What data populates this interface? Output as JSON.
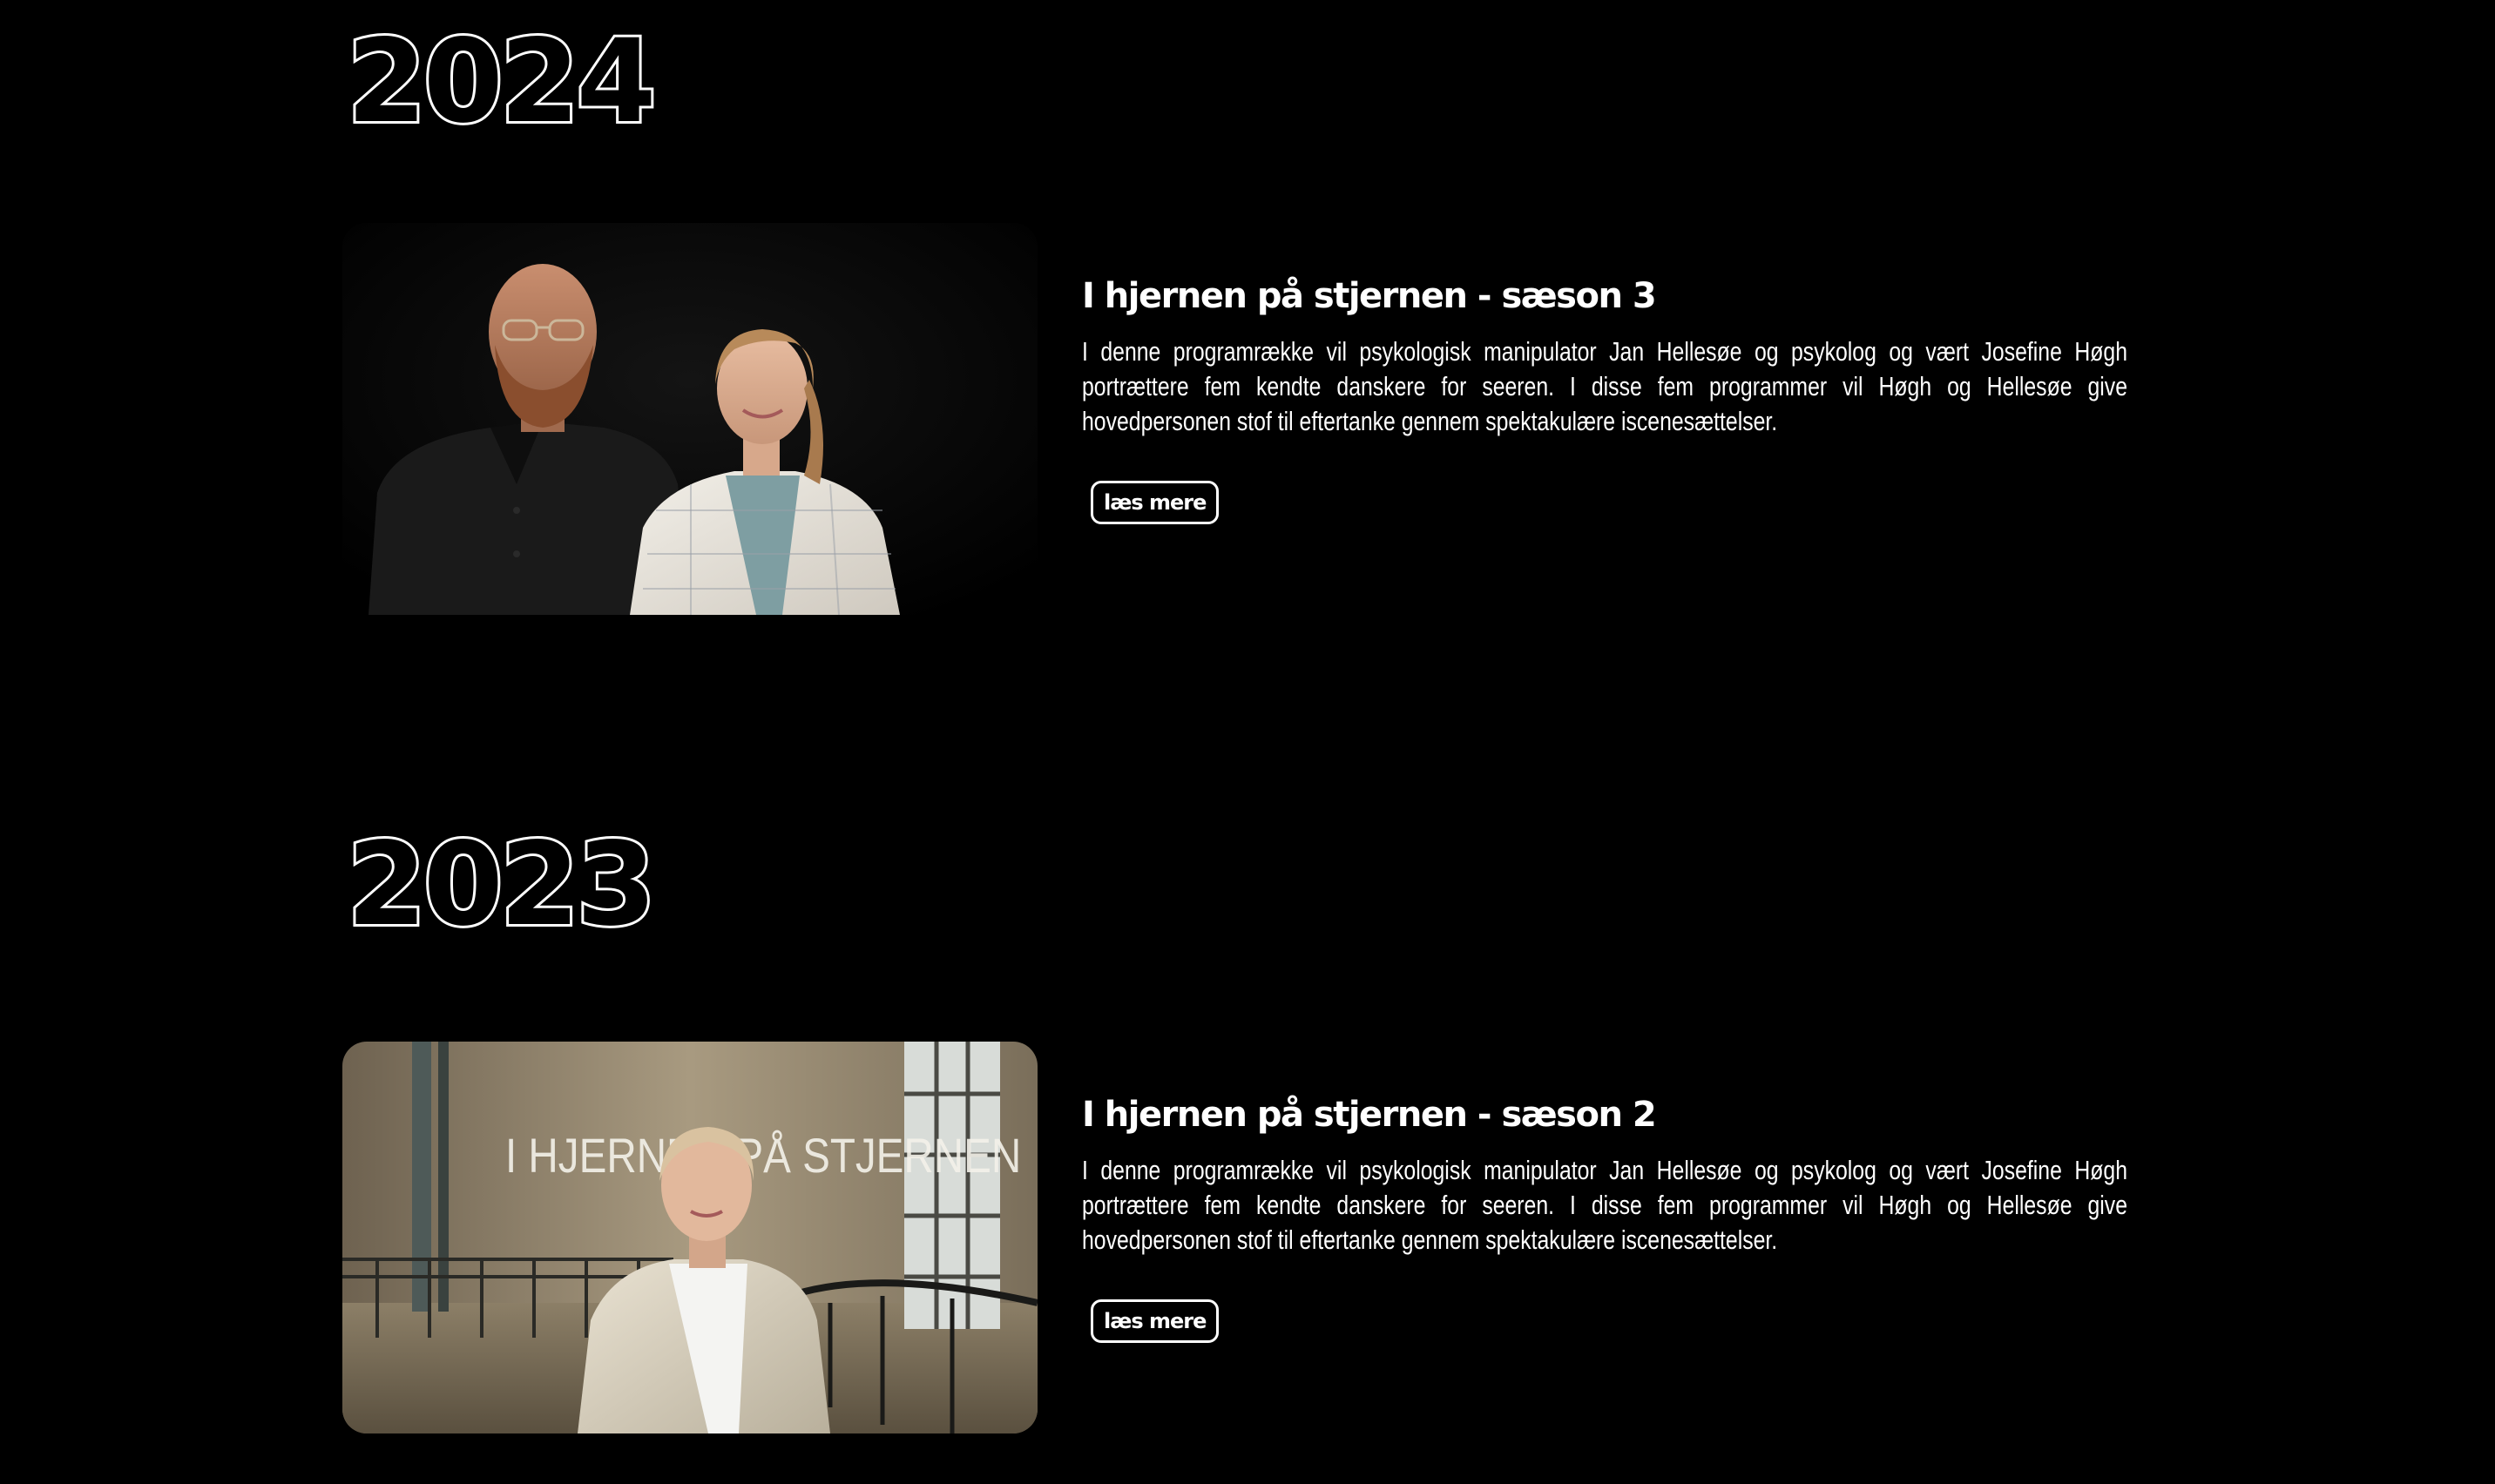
{
  "sections": [
    {
      "year": "2024",
      "show": {
        "title": "I hjernen på stjernen - sæson 3",
        "description": "I denne programrække vil psykologisk manipulator Jan Hellesøe og psykolog og vært Josefine Høgh portrættere fem kendte danskere for seeren. I disse fem programmer vil Høgh og Hellesøe give hovedpersonen stof til eftertanke gennem spektakulære iscenesættelser.",
        "read_more_label": "læs mere",
        "image": "promo-photo-two-hosts"
      }
    },
    {
      "year": "2023",
      "show": {
        "title": "I hjernen på stjernen - sæson 2",
        "description": "I denne programrække vil psykologisk manipulator Jan Hellesøe og psykolog og vært Josefine Høgh portrættere fem kendte danskere for seeren. I disse fem programmer vil Høgh og Hellesøe give hovedpersonen stof til eftertanke gennem spektakulære iscenesættelser.",
        "read_more_label": "læs mere",
        "image": "promo-photo-host-factory-hall",
        "image_overlay_text": "I HJERNEN PÅ STJERNEN"
      }
    }
  ],
  "colors": {
    "background": "#000000",
    "text": "#ffffff"
  }
}
